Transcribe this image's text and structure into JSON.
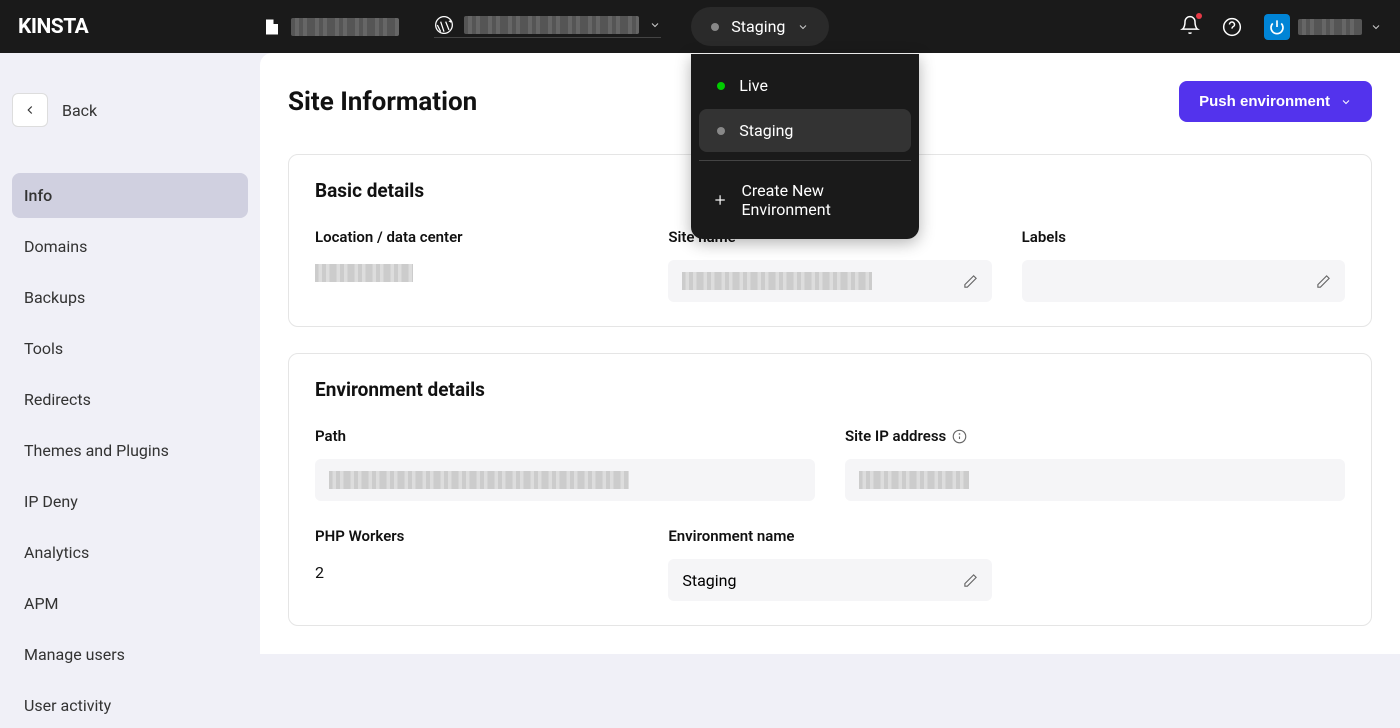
{
  "header": {
    "logo_text": "KINSTA",
    "env_selected": "Staging",
    "env_options": {
      "live": "Live",
      "staging": "Staging"
    },
    "create_env": "Create New Environment"
  },
  "sidebar": {
    "back_label": "Back",
    "items": [
      "Info",
      "Domains",
      "Backups",
      "Tools",
      "Redirects",
      "Themes and Plugins",
      "IP Deny",
      "Analytics",
      "APM",
      "Manage users",
      "User activity"
    ]
  },
  "main": {
    "page_title": "Site Information",
    "push_button": "Push environment",
    "basic_details": {
      "title": "Basic details",
      "location_label": "Location / data center",
      "site_name_label": "Site name",
      "labels_label": "Labels"
    },
    "env_details": {
      "title": "Environment details",
      "path_label": "Path",
      "ip_label": "Site IP address",
      "php_workers_label": "PHP Workers",
      "php_workers_value": "2",
      "env_name_label": "Environment name",
      "env_name_value": "Staging"
    }
  }
}
